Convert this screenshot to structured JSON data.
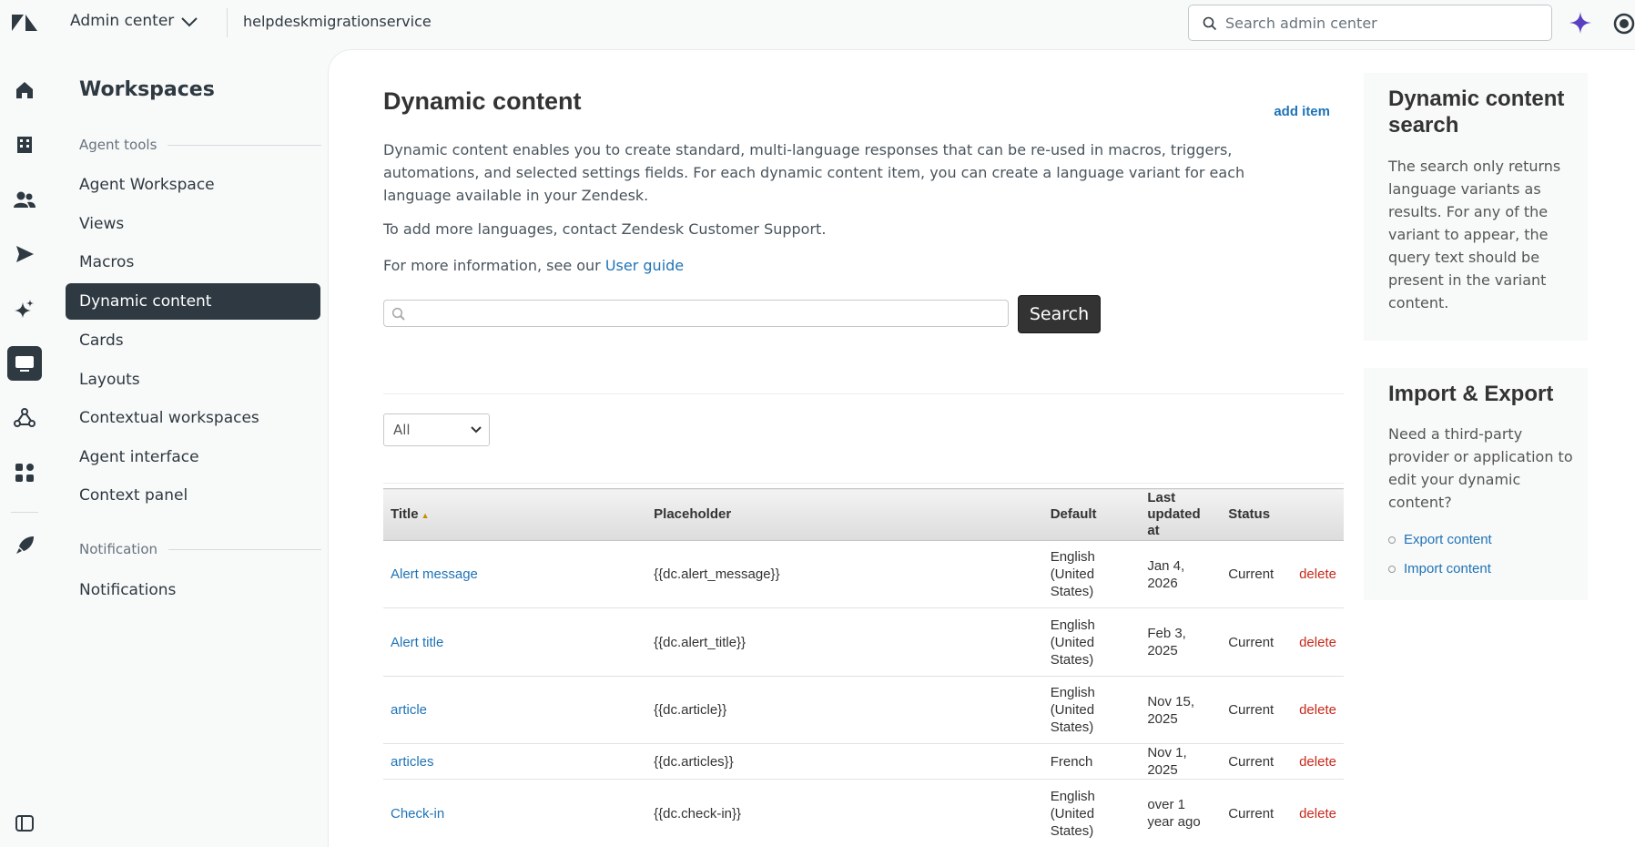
{
  "header": {
    "product": "Admin center",
    "subdomain": "helpdeskmigrationservice",
    "search_placeholder": "Search admin center"
  },
  "sidenav": {
    "title": "Workspaces",
    "groups": [
      {
        "label": "Agent tools"
      },
      {
        "label": "Notification"
      }
    ],
    "items": [
      {
        "label": "Agent Workspace"
      },
      {
        "label": "Views"
      },
      {
        "label": "Macros"
      },
      {
        "label": "Dynamic content"
      },
      {
        "label": "Cards"
      },
      {
        "label": "Layouts"
      },
      {
        "label": "Contextual workspaces"
      },
      {
        "label": "Agent interface"
      },
      {
        "label": "Context panel"
      },
      {
        "label": "Notifications"
      }
    ]
  },
  "main": {
    "title": "Dynamic content",
    "add_item": "add item",
    "description": "Dynamic content enables you to create standard, multi-language responses that can be re-used in macros, triggers, automations, and selected settings fields. For each dynamic content item, you can create a language variant for each language available in your Zendesk.",
    "languages_note": "To add more languages, contact Zendesk Customer Support.",
    "info_prefix": "For more information, see our ",
    "info_link": "User guide",
    "search_button": "Search",
    "filter_value": "All",
    "table": {
      "headers": {
        "title": "Title",
        "placeholder": "Placeholder",
        "default": "Default",
        "updated": "Last updated at",
        "status": "Status"
      },
      "rows": [
        {
          "title": "Alert message",
          "placeholder": "{{dc.alert_message}}",
          "default": "English (United States)",
          "updated": "Jan 4, 2026",
          "status": "Current",
          "action": "delete"
        },
        {
          "title": "Alert title",
          "placeholder": "{{dc.alert_title}}",
          "default": "English (United States)",
          "updated": "Feb 3, 2025",
          "status": "Current",
          "action": "delete"
        },
        {
          "title": "article",
          "placeholder": "{{dc.article}}",
          "default": "English (United States)",
          "updated": "Nov 15, 2025",
          "status": "Current",
          "action": "delete"
        },
        {
          "title": "articles",
          "placeholder": "{{dc.articles}}",
          "default": "French",
          "updated": "Nov 1, 2025",
          "status": "Current",
          "action": "delete"
        },
        {
          "title": "Check-in",
          "placeholder": "{{dc.check-in}}",
          "default": "English (United States)",
          "updated": "over 1 year ago",
          "status": "Current",
          "action": "delete"
        }
      ]
    }
  },
  "side_panels": {
    "search": {
      "title": "Dynamic content search",
      "text": "The search only returns language variants as results. For any of the variant to appear, the query text should be present in the variant content."
    },
    "import_export": {
      "title": "Import & Export",
      "text": "Need a third-party provider or application to edit your dynamic content?",
      "export_link": "Export content",
      "import_link": "Import content"
    }
  }
}
